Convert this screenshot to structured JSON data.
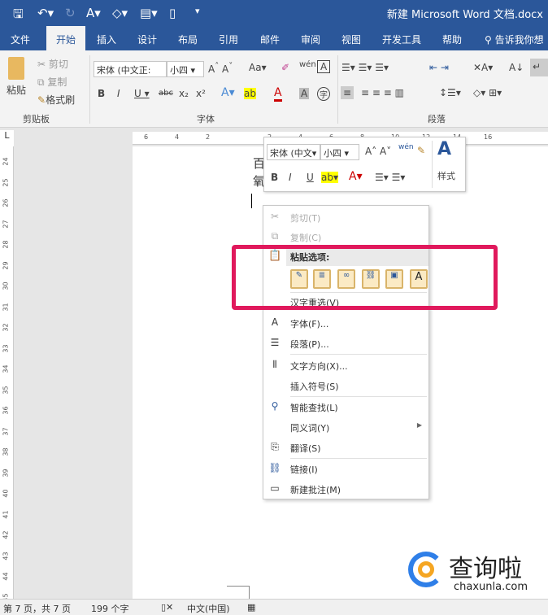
{
  "titlebar": {
    "title": "新建 Microsoft Word 文档.docx"
  },
  "tabs": [
    "文件",
    "开始",
    "插入",
    "设计",
    "布局",
    "引用",
    "邮件",
    "审阅",
    "视图",
    "开发工具",
    "帮助"
  ],
  "tell_me": "告诉我你想",
  "ribbon": {
    "clipboard": {
      "paste": "粘贴",
      "cut": "剪切",
      "copy": "复制",
      "format_painter": "格式刷",
      "label": "剪贴板"
    },
    "font": {
      "font_name": "宋体 (中文正:",
      "font_size": "小四",
      "label": "字体",
      "change_case": "Aa"
    },
    "paragraph": {
      "label": "段落"
    }
  },
  "mini_toolbar": {
    "font_name": "宋体 (中文",
    "font_size": "小四",
    "styles": "样式"
  },
  "document": {
    "line1": "百",
    "line2": "氧"
  },
  "context_menu": {
    "items": [
      {
        "label": "剪切(T)",
        "icon": "scissors-icon",
        "disabled": true
      },
      {
        "label": "复制(C)",
        "icon": "copy-icon",
        "disabled": true
      },
      {
        "label": "粘贴选项:",
        "icon": "paste-icon"
      },
      {
        "label": "汉字重选(V)"
      },
      {
        "label": "字体(F)...",
        "icon": "font-icon"
      },
      {
        "label": "段落(P)...",
        "icon": "paragraph-icon"
      },
      {
        "label": "文字方向(X)...",
        "icon": "text-direction-icon"
      },
      {
        "label": "插入符号(S)"
      },
      {
        "label": "智能查找(L)",
        "icon": "smart-lookup-icon"
      },
      {
        "label": "同义词(Y)",
        "submenu": true
      },
      {
        "label": "翻译(S)",
        "icon": "translate-icon"
      },
      {
        "label": "链接(I)",
        "icon": "link-icon"
      },
      {
        "label": "新建批注(M)",
        "icon": "comment-icon"
      }
    ]
  },
  "status": {
    "page": "第 7 页，共 7 页",
    "words": "199 个字",
    "language": "中文(中国)"
  },
  "ruler": {
    "h": [
      "6",
      "4",
      "2",
      "",
      "2",
      "4",
      "6",
      "8",
      "10",
      "12",
      "14",
      "16"
    ],
    "v": [
      "24",
      "25",
      "26",
      "27",
      "28",
      "29",
      "30",
      "31",
      "32",
      "33",
      "34",
      "35",
      "36",
      "37",
      "38",
      "39",
      "40",
      "41",
      "42",
      "43",
      "44",
      "45"
    ]
  },
  "watermark": {
    "name": "查询啦",
    "url": "chaxunla.com"
  },
  "colors": {
    "accent": "#2b579a",
    "highlight_box": "#e0195c"
  }
}
